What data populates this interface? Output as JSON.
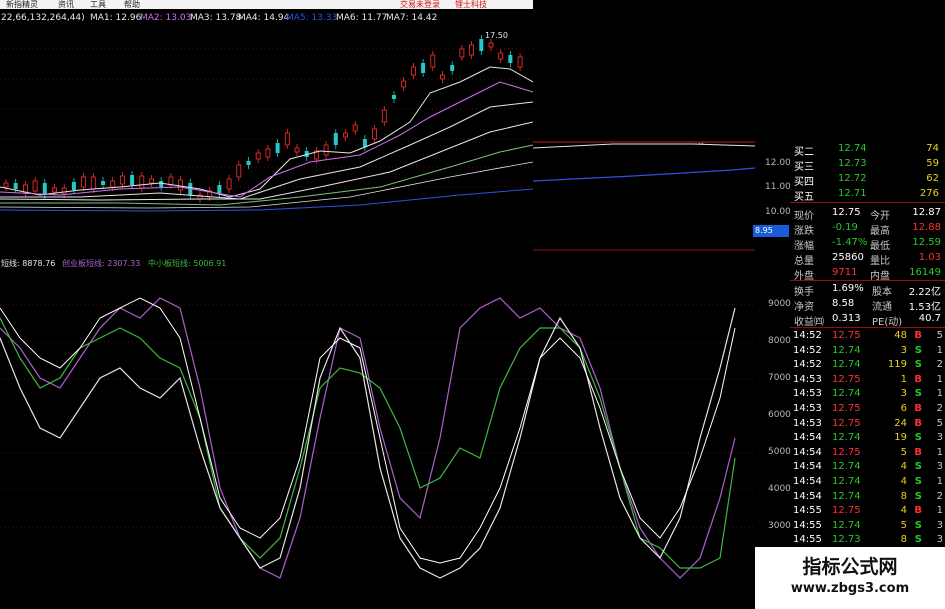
{
  "menu": {
    "items": [
      "新指精灵",
      "资讯",
      "工具",
      "帮助"
    ],
    "links": [
      "交易未登录",
      "锂士科技"
    ]
  },
  "ma": {
    "params": "22,66,132,264,44)",
    "lines": [
      {
        "label": "MA1: 12.96",
        "color": "#e6e6e6"
      },
      {
        "label": "MA2: 13.03",
        "color": "#d070f0"
      },
      {
        "label": "MA3: 13.78",
        "color": "#e6e6e6"
      },
      {
        "label": "MA4: 14.94",
        "color": "#e6e6e6"
      },
      {
        "label": "MA5: 13.33",
        "color": "#3050e0"
      },
      {
        "label": "MA6: 11.77",
        "color": "#e6e6e6"
      },
      {
        "label": "MA7: 14.42",
        "color": "#e6e6e6"
      }
    ]
  },
  "price_axis": {
    "ticks": [
      "12.00",
      "11.00",
      "10.00"
    ],
    "flag": "8.95",
    "high_label": "17.50"
  },
  "quote": {
    "bids": [
      {
        "label": "买二",
        "price": "12.74",
        "vol": "74"
      },
      {
        "label": "买三",
        "price": "12.73",
        "vol": "59"
      },
      {
        "label": "买四",
        "price": "12.72",
        "vol": "62"
      },
      {
        "label": "买五",
        "price": "12.71",
        "vol": "276"
      }
    ],
    "stats": [
      {
        "l1": "现价",
        "v1": "12.75",
        "l2": "今开",
        "v2": "12.87",
        "c1": "#ffffff",
        "c2": "#ffffff"
      },
      {
        "l1": "涨跌",
        "v1": "-0.19",
        "l2": "最高",
        "v2": "12.88",
        "c1": "#28c828",
        "c2": "#ff3030"
      },
      {
        "l1": "涨幅",
        "v1": "-1.47%",
        "l2": "最低",
        "v2": "12.59",
        "c1": "#28c828",
        "c2": "#28c828"
      },
      {
        "l1": "总量",
        "v1": "25860",
        "l2": "量比",
        "v2": "1.03",
        "c1": "#ffffff",
        "c2": "#ff3030"
      },
      {
        "l1": "外盘",
        "v1": "9711",
        "l2": "内盘",
        "v2": "16149",
        "c1": "#ff3030",
        "c2": "#28c828"
      }
    ],
    "stats2": [
      {
        "l1": "换手",
        "v1": "1.69%",
        "l2": "股本",
        "v2": "2.22亿"
      },
      {
        "l1": "净资",
        "v1": "8.58",
        "l2": "流通",
        "v2": "1.53亿"
      },
      {
        "l1": "收益㈣",
        "v1": "0.313",
        "l2": "PE(动)",
        "v2": "40.7"
      }
    ],
    "ticks": [
      {
        "time": "14:52",
        "price": "12.75",
        "vol": "48",
        "side": "B",
        "n": "5"
      },
      {
        "time": "14:52",
        "price": "12.74",
        "vol": "3",
        "side": "S",
        "n": "1"
      },
      {
        "time": "14:52",
        "price": "12.74",
        "vol": "119",
        "side": "S",
        "n": "2"
      },
      {
        "time": "14:53",
        "price": "12.75",
        "vol": "1",
        "side": "B",
        "n": "1"
      },
      {
        "time": "14:53",
        "price": "12.74",
        "vol": "3",
        "side": "S",
        "n": "1"
      },
      {
        "time": "14:53",
        "price": "12.75",
        "vol": "6",
        "side": "B",
        "n": "2"
      },
      {
        "time": "14:53",
        "price": "12.75",
        "vol": "24",
        "side": "B",
        "n": "5"
      },
      {
        "time": "14:54",
        "price": "12.74",
        "vol": "19",
        "side": "S",
        "n": "3"
      },
      {
        "time": "14:54",
        "price": "12.75",
        "vol": "5",
        "side": "B",
        "n": "1"
      },
      {
        "time": "14:54",
        "price": "12.74",
        "vol": "4",
        "side": "S",
        "n": "3"
      },
      {
        "time": "14:54",
        "price": "12.74",
        "vol": "4",
        "side": "S",
        "n": "1"
      },
      {
        "time": "14:54",
        "price": "12.74",
        "vol": "8",
        "side": "S",
        "n": "2"
      },
      {
        "time": "14:55",
        "price": "12.75",
        "vol": "4",
        "side": "B",
        "n": "1"
      },
      {
        "time": "14:55",
        "price": "12.74",
        "vol": "5",
        "side": "S",
        "n": "3"
      },
      {
        "time": "14:55",
        "price": "12.73",
        "vol": "8",
        "side": "S",
        "n": "3"
      },
      {
        "time": "14:55",
        "price": "12.73",
        "vol": "8",
        "side": "S",
        "n": "5"
      }
    ]
  },
  "indicator": {
    "legend": [
      {
        "label": "短线: 8878.76",
        "color": "#e6e6e6"
      },
      {
        "label": "创业板短线: 2307.33",
        "color": "#b060d0"
      },
      {
        "label": "中小板短线: 5006.91",
        "color": "#40b840"
      }
    ],
    "ticks": [
      "9000",
      "8000",
      "7000",
      "6000",
      "5000",
      "4000",
      "3000"
    ]
  },
  "watermark": {
    "title": "指标公式网",
    "url": "www.zbgs3.com"
  },
  "colors": {
    "up": "#ff3030",
    "down": "#28c828",
    "separator": "#8b1010",
    "grid": "#7a0c0c"
  }
}
